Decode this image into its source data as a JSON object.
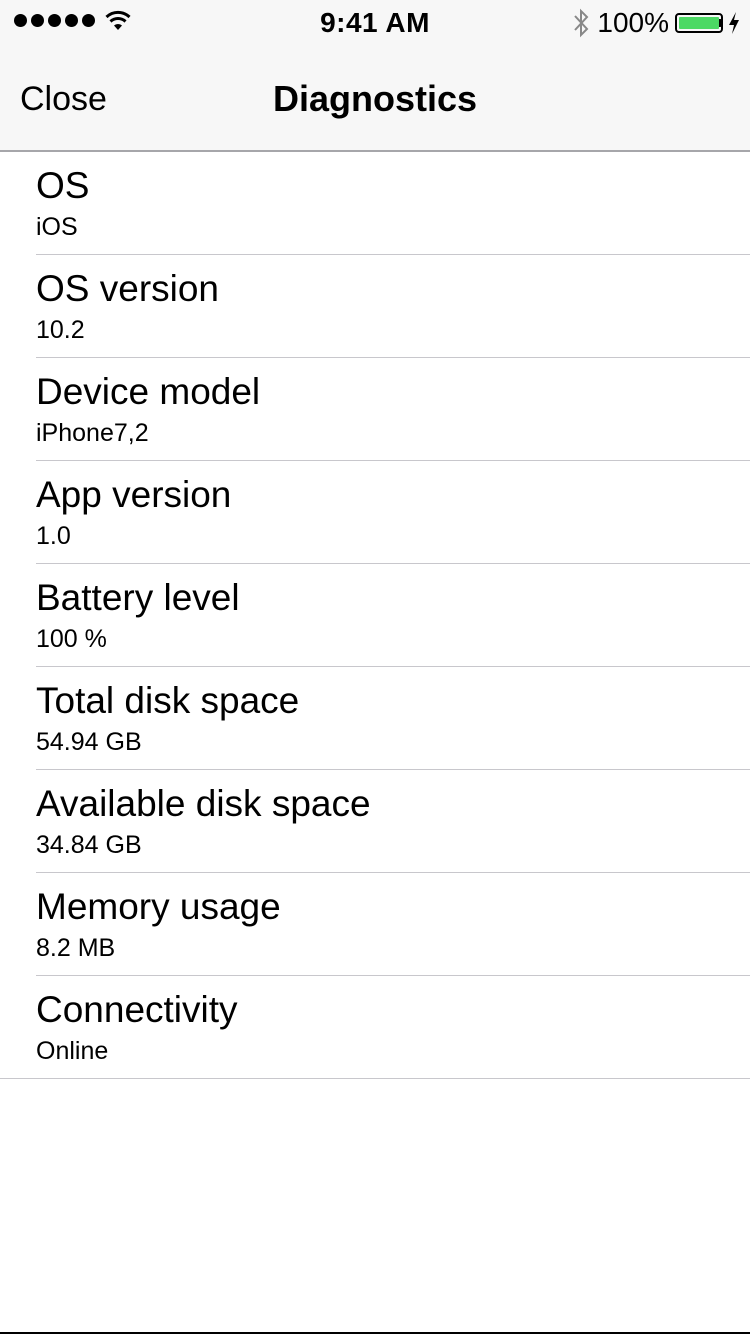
{
  "status_bar": {
    "time": "9:41 AM",
    "battery_text": "100%",
    "battery_level": 1.0,
    "battery_color": "#4cd964",
    "signal_bars": 5,
    "icons": [
      "signal-dots-icon",
      "wifi-icon",
      "bluetooth-icon",
      "battery-icon",
      "charging-bolt-icon"
    ]
  },
  "nav": {
    "close_label": "Close",
    "title": "Diagnostics"
  },
  "rows": [
    {
      "title": "OS",
      "value": "iOS"
    },
    {
      "title": "OS version",
      "value": "10.2"
    },
    {
      "title": "Device model",
      "value": "iPhone7,2"
    },
    {
      "title": "App version",
      "value": "1.0"
    },
    {
      "title": "Battery level",
      "value": "100 %"
    },
    {
      "title": "Total disk space",
      "value": "54.94 GB"
    },
    {
      "title": "Available disk space",
      "value": "34.84 GB"
    },
    {
      "title": "Memory usage",
      "value": "8.2 MB"
    },
    {
      "title": "Connectivity",
      "value": "Online"
    }
  ]
}
